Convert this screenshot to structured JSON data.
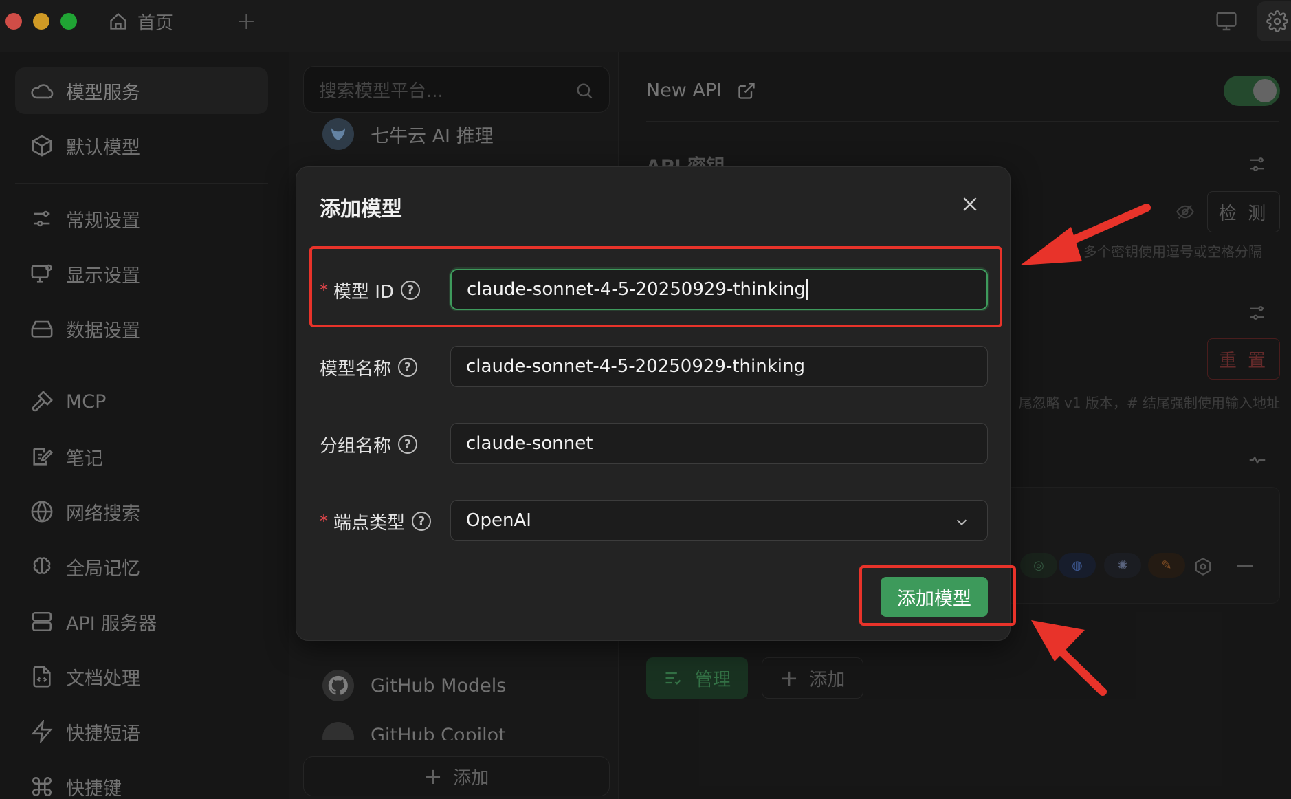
{
  "titlebar": {
    "home_tab_label": "首页"
  },
  "sidebar": {
    "items": [
      {
        "label": "模型服务",
        "icon": "cloud-icon"
      },
      {
        "label": "默认模型",
        "icon": "cube-icon"
      },
      {
        "label": "常规设置",
        "icon": "sliders-icon"
      },
      {
        "label": "显示设置",
        "icon": "monitor-settings-icon"
      },
      {
        "label": "数据设置",
        "icon": "hard-drive-icon"
      },
      {
        "label": "MCP",
        "icon": "hammer-icon"
      },
      {
        "label": "笔记",
        "icon": "note-edit-icon"
      },
      {
        "label": "网络搜索",
        "icon": "globe-icon"
      },
      {
        "label": "全局记忆",
        "icon": "brain-icon"
      },
      {
        "label": "API 服务器",
        "icon": "server-icon"
      },
      {
        "label": "文档处理",
        "icon": "file-code-icon"
      },
      {
        "label": "快捷短语",
        "icon": "zap-icon"
      },
      {
        "label": "快捷键",
        "icon": "command-icon"
      }
    ]
  },
  "providers": {
    "search_placeholder": "搜索模型平台...",
    "items": [
      {
        "label": "七牛云 AI 推理"
      },
      {
        "label": "GitHub Models"
      },
      {
        "label": "GitHub Copilot"
      }
    ],
    "add_label": "添加"
  },
  "main": {
    "provider_name": "New API",
    "api_key_label": "API 密钥",
    "check_label": "检 测",
    "key_hint": "多个密钥使用逗号或空格分隔",
    "reset_label": "重 置",
    "url_hint": "尾忽略 v1 版本，# 结尾强制使用输入地址",
    "manage_label": "管理",
    "add_label": "添加"
  },
  "modal": {
    "title": "添加模型",
    "fields": {
      "model_id": {
        "label": "模型 ID",
        "value": "claude-sonnet-4-5-20250929-thinking",
        "required": true
      },
      "model_name": {
        "label": "模型名称",
        "value": "claude-sonnet-4-5-20250929-thinking",
        "required": false
      },
      "group_name": {
        "label": "分组名称",
        "value": "claude-sonnet",
        "required": false
      },
      "endpoint_type": {
        "label": "端点类型",
        "value": "OpenAI",
        "required": true
      }
    },
    "submit_label": "添加模型"
  },
  "colors": {
    "accent_green": "#3d9a5b",
    "annotation_red": "#e8332a",
    "required_red": "#e0454a"
  }
}
